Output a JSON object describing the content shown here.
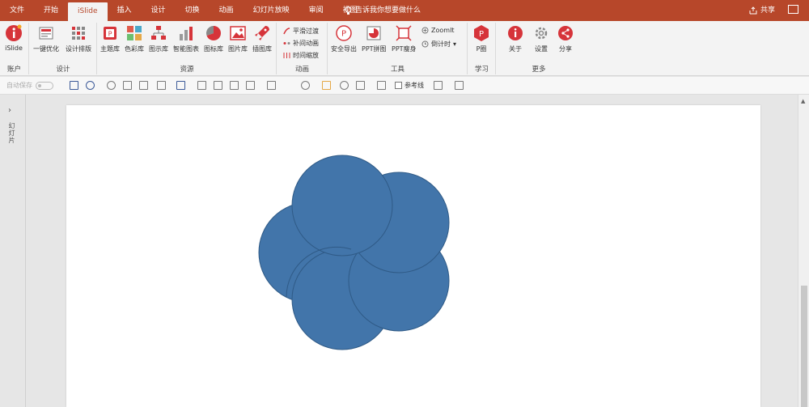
{
  "titlebar": {
    "tabs": [
      {
        "label": "文件",
        "active": false
      },
      {
        "label": "开始",
        "active": false
      },
      {
        "label": "iSlide",
        "active": true
      },
      {
        "label": "插入",
        "active": false
      },
      {
        "label": "设计",
        "active": false
      },
      {
        "label": "切换",
        "active": false
      },
      {
        "label": "动画",
        "active": false
      },
      {
        "label": "幻灯片放映",
        "active": false
      },
      {
        "label": "审阅",
        "active": false
      },
      {
        "label": "视图",
        "active": false
      }
    ],
    "tell_me": "告诉我你想要做什么",
    "share": "共享"
  },
  "ribbon": {
    "groups": {
      "account": "账户",
      "design": "设计",
      "resources": "资源",
      "animation": "动画",
      "tools": "工具",
      "learn": "学习",
      "more": "更多"
    },
    "buttons": {
      "islide": "iSlide",
      "one_click_optimize": "一键优化",
      "design_layout": "设计排版",
      "theme_lib": "主题库",
      "color_lib": "色彩库",
      "diagram_lib": "图示库",
      "smart_chart": "智能图表",
      "icon_lib": "图标库",
      "image_lib": "图片库",
      "illustration_lib": "插图库",
      "smooth_transition": "平滑过渡",
      "tween_animation": "补间动画",
      "time_scale": "时间缩放",
      "safe_export": "安全导出",
      "ppt_collage": "PPT拼图",
      "ppt_slim": "PPT瘦身",
      "zoomit": "ZoomIt",
      "countdown": "倒计时",
      "p_circle": "P圈",
      "about": "关于",
      "settings": "设置",
      "share": "分享"
    }
  },
  "quick_toolbar": {
    "autosave": "自动保存",
    "reference_line": "参考线"
  },
  "left_pane": {
    "label": "幻灯片"
  },
  "colors": {
    "accent": "#b7472a",
    "shape_fill": "#4275aa",
    "shape_stroke": "#2f5a86"
  }
}
